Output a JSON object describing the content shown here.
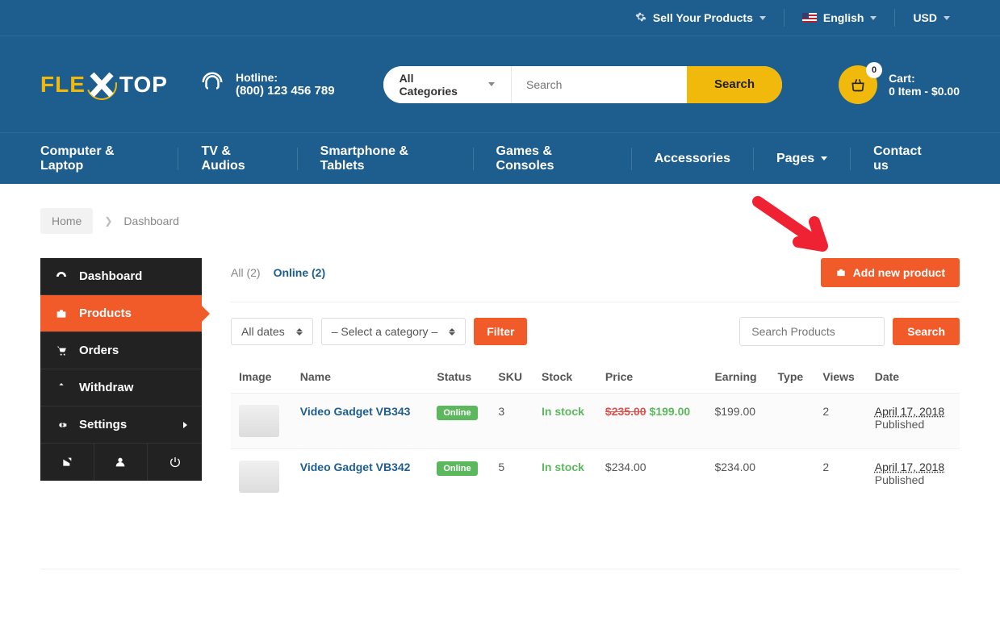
{
  "topbar": {
    "sell_label": "Sell Your Products",
    "language_label": "English",
    "currency_label": "USD"
  },
  "header": {
    "logo_part1": "FLE",
    "logo_part2": "TOP",
    "hotline_label": "Hotline:",
    "hotline_number": "(800) 123 456 789",
    "category_selected": "All Categories",
    "search_placeholder": "Search",
    "search_button": "Search",
    "cart_label": "Cart:",
    "cart_value": "0 Item - $0.00",
    "cart_count": "0"
  },
  "nav": {
    "items": [
      "Computer & Laptop",
      "TV & Audios",
      "Smartphone & Tablets",
      "Games & Consoles",
      "Accessories",
      "Pages",
      "Contact us"
    ]
  },
  "breadcrumb": {
    "home": "Home",
    "current": "Dashboard"
  },
  "sidebar": {
    "items": [
      {
        "label": "Dashboard"
      },
      {
        "label": "Products"
      },
      {
        "label": "Orders"
      },
      {
        "label": "Withdraw"
      },
      {
        "label": "Settings"
      }
    ]
  },
  "tabs": {
    "all_label": "All (2)",
    "online_label": "Online (2)"
  },
  "buttons": {
    "add_product": "Add new product",
    "filter": "Filter",
    "search": "Search"
  },
  "filters": {
    "dates_selected": "All dates",
    "category_selected": "– Select a category –",
    "search_placeholder": "Search Products"
  },
  "table": {
    "headers": {
      "image": "Image",
      "name": "Name",
      "status": "Status",
      "sku": "SKU",
      "stock": "Stock",
      "price": "Price",
      "earning": "Earning",
      "type": "Type",
      "views": "Views",
      "date": "Date"
    },
    "rows": [
      {
        "name": "Video Gadget VB343",
        "status": "Online",
        "sku": "3",
        "stock": "In stock",
        "old_price": "$235.00",
        "price": "$199.00",
        "earning": "$199.00",
        "views": "2",
        "date": "April 17, 2018",
        "date_status": "Published"
      },
      {
        "name": "Video Gadget VB342",
        "status": "Online",
        "sku": "5",
        "stock": "In stock",
        "old_price": "",
        "price": "$234.00",
        "earning": "$234.00",
        "views": "2",
        "date": "April 17, 2018",
        "date_status": "Published"
      }
    ]
  }
}
